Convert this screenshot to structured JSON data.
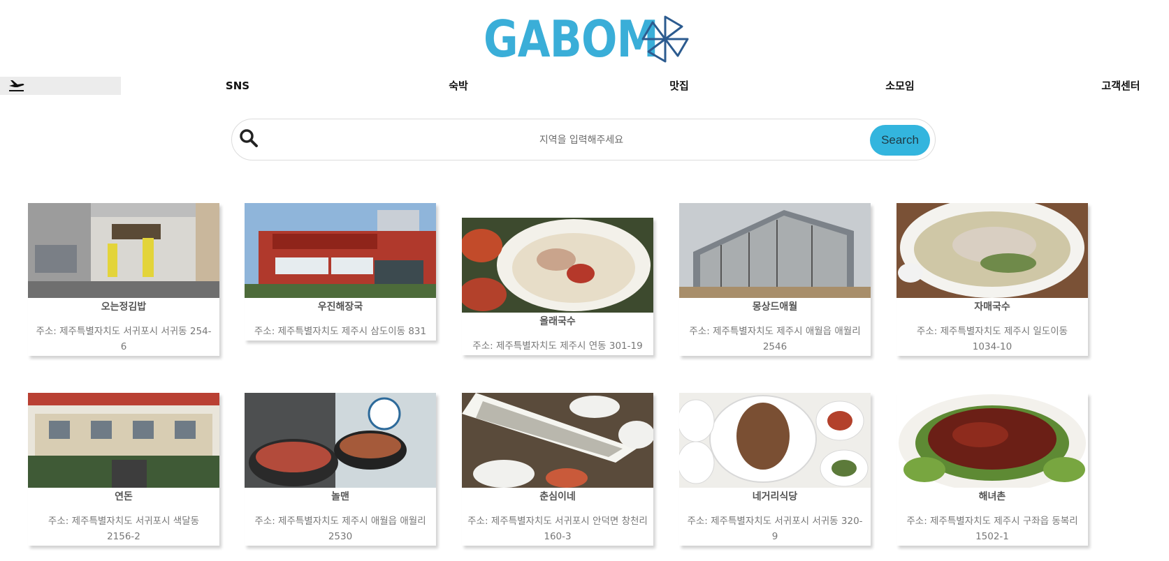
{
  "logo": {
    "text": "GABOM",
    "color": "#3aaed8",
    "pinwheel_color": "#2c5b8f"
  },
  "nav": {
    "home_icon": "airplane-icon",
    "items": [
      {
        "label": "SNS"
      },
      {
        "label": "숙박"
      },
      {
        "label": "맛집"
      },
      {
        "label": "소모임"
      },
      {
        "label": "고객센터"
      }
    ]
  },
  "search": {
    "icon": "search-icon",
    "placeholder": "지역을 입력해주세요",
    "value": "",
    "button_label": "Search",
    "button_color": "#33b5de"
  },
  "restaurants": [
    {
      "name": "오는정김밥",
      "address": "주소: 제주특별자치도 서귀포시 서귀동 254-6"
    },
    {
      "name": "우진해장국",
      "address": "주소: 제주특별자치도 제주시 삼도이동 831"
    },
    {
      "name": "올래국수",
      "address": "주소: 제주특별자치도 제주시 연동 301-19"
    },
    {
      "name": "몽상드애월",
      "address": "주소: 제주특별자치도 제주시 애월읍 애월리 2546"
    },
    {
      "name": "자매국수",
      "address": "주소: 제주특별자치도 제주시 일도이동 1034-10"
    },
    {
      "name": "연돈",
      "address": "주소: 제주특별자치도 서귀포시 색달동 2156-2"
    },
    {
      "name": "놀맨",
      "address": "주소: 제주특별자치도 제주시 애월읍 애월리 2530"
    },
    {
      "name": "춘심이네",
      "address": "주소: 제주특별자치도 서귀포시 안덕면 창천리 160-3"
    },
    {
      "name": "네거리식당",
      "address": "주소: 제주특별자치도 서귀포시 서귀동 320-9"
    },
    {
      "name": "해녀촌",
      "address": "주소: 제주특별자치도 제주시 구좌읍 동복리 1502-1"
    }
  ]
}
